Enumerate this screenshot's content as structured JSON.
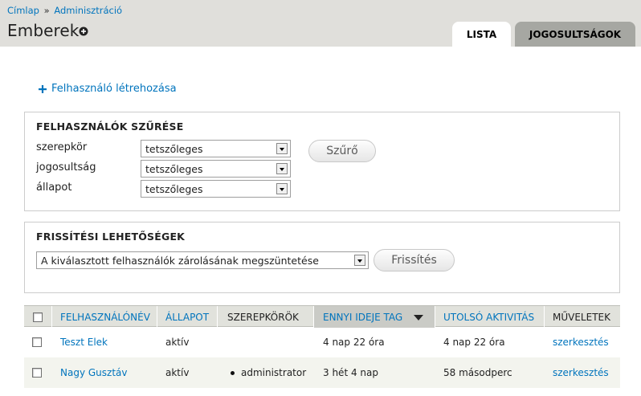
{
  "breadcrumb": {
    "home": "Címlap",
    "separator": "»",
    "admin": "Adminisztráció"
  },
  "page_title": "Emberek",
  "tabs": [
    {
      "label": "Lista",
      "active": true
    },
    {
      "label": "Jogosultságok",
      "active": false
    }
  ],
  "add_user_link": "Felhasználó létrehozása",
  "filter": {
    "legend": "Felhasználók szűrése",
    "rows": [
      {
        "label": "szerepkör",
        "value": "tetszőleges"
      },
      {
        "label": "jogosultság",
        "value": "tetszőleges"
      },
      {
        "label": "állapot",
        "value": "tetszőleges"
      }
    ],
    "button": "Szűrő"
  },
  "update": {
    "legend": "Frissítési lehetőségek",
    "selected_option": "A kiválasztott felhasználók zárolásának megszüntetése",
    "button": "Frissítés"
  },
  "table": {
    "headers": [
      "Felhasználónév",
      "Állapot",
      "Szerepkörök",
      "Ennyi ideje tag",
      "Utolsó aktivitás",
      "Műveletek"
    ],
    "sorted_column": "Ennyi ideje tag",
    "rows": [
      {
        "username": "Teszt Elek",
        "status": "aktív",
        "roles": "",
        "member_for": "4 nap 22 óra",
        "last_access": "4 nap 22 óra",
        "action": "szerkesztés"
      },
      {
        "username": "Nagy Gusztáv",
        "status": "aktív",
        "roles": "administrator",
        "member_for": "3 hét 4 nap",
        "last_access": "58 másodperc",
        "action": "szerkesztés"
      }
    ]
  },
  "colors": {
    "link": "#0074bd",
    "header_bg": "#e0dfdb",
    "inactive_tab": "#a6a7a2",
    "table_head": "#e1e2dc"
  }
}
